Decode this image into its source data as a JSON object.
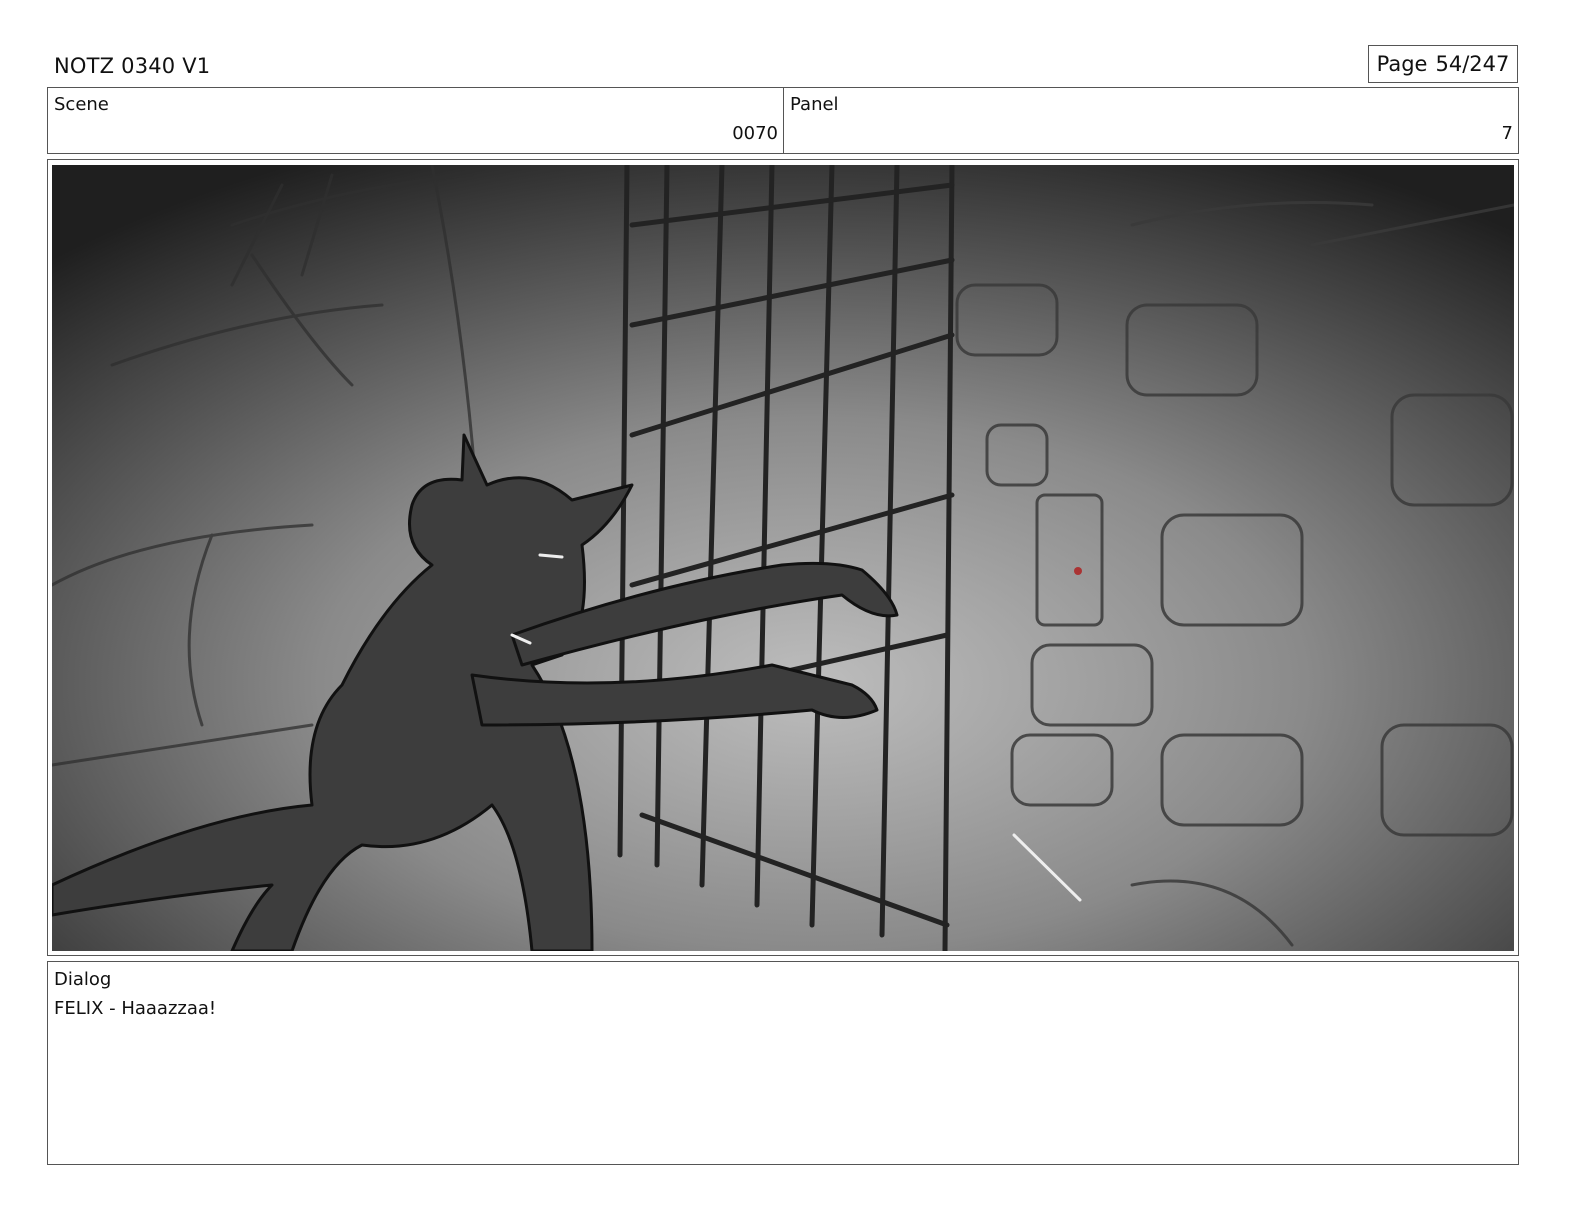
{
  "header": {
    "title": "NOTZ 0340 V1",
    "page_label": "Page",
    "page_number": "54/247"
  },
  "scene": {
    "label": "Scene",
    "value": "0070"
  },
  "panel": {
    "label": "Panel",
    "value": "7"
  },
  "illustration": {
    "icon": "storyboard-sketch"
  },
  "dialog": {
    "label": "Dialog",
    "text": "FELIX - Haaazzaa!"
  }
}
